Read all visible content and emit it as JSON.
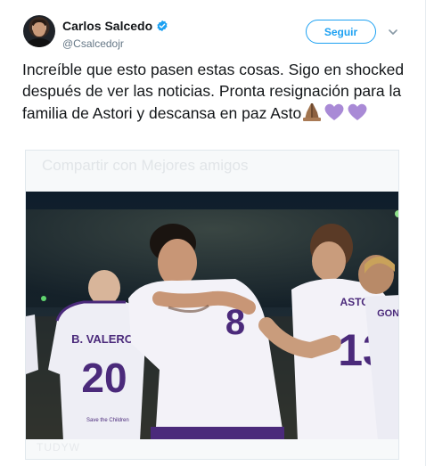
{
  "tweet": {
    "author": {
      "display_name": "Carlos Salcedo",
      "handle": "@Csalcedojr",
      "verified": true
    },
    "follow_label": "Seguir",
    "text": "Increíble que esto pasen estas cosas. Sigo en shocked después de ver las noticias. Pronta resignación para la familia de Astori y descansa en paz Asto",
    "emojis": [
      "folded-hands-emoji",
      "purple-heart-emoji",
      "purple-heart-emoji"
    ],
    "media": {
      "overlay_text": "Compartir con Mejores amigos",
      "bottom_text": "TUDYW",
      "players": [
        {
          "number": "20",
          "name": "B. VALERO"
        },
        {
          "number": "8",
          "name": ""
        },
        {
          "number": "13",
          "name": "ASTORI"
        },
        {
          "number": "",
          "name": "GONZ"
        }
      ],
      "sponsor_text": "Save the Children"
    }
  },
  "colors": {
    "accent": "#1da1f2",
    "text": "#14171a",
    "muted": "#657786",
    "jersey_purple": "#4b2a7b",
    "jersey_white": "#f1f0f6"
  }
}
